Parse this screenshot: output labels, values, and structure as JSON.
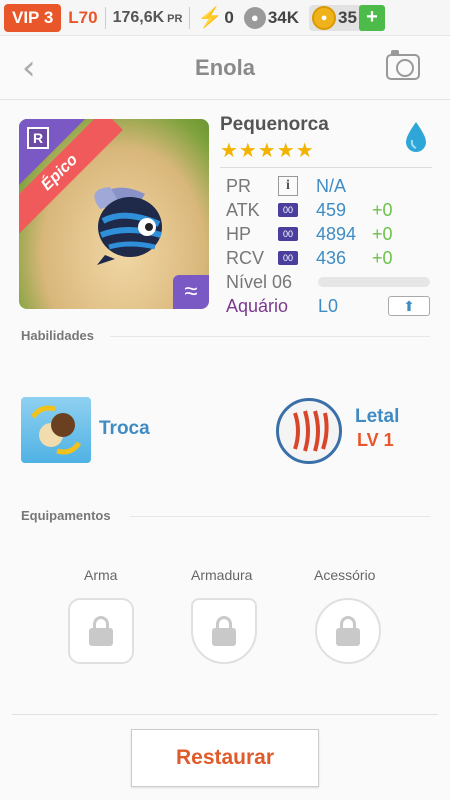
{
  "topbar": {
    "vip": "VIP 3",
    "level": "L70",
    "power": "176,6K",
    "power_unit": "PR",
    "energy": "0",
    "food": "34K",
    "coins": "35",
    "add_label": "+"
  },
  "header": {
    "title": "Enola",
    "back_icon": "chevron-left-icon",
    "camera_icon": "camera-icon"
  },
  "pet": {
    "rarity_badge": "R",
    "rarity": "Épico",
    "element_icon": "water-drop-icon",
    "name": "Pequenorca",
    "stars": 5,
    "stats": [
      {
        "label": "PR",
        "tag": "i",
        "value": "N/A",
        "bonus": ""
      },
      {
        "label": "ATK",
        "tag": "00",
        "value": "459",
        "bonus": "+0"
      },
      {
        "label": "HP",
        "tag": "00",
        "value": "4894",
        "bonus": "+0"
      },
      {
        "label": "RCV",
        "tag": "00",
        "value": "436",
        "bonus": "+0"
      }
    ],
    "level_label": "Nível 06",
    "level_progress": 0,
    "aquarium_label": "Aquário",
    "aquarium_value": "L0"
  },
  "skills": {
    "section_title": "Habilidades",
    "active": {
      "name": "Troca"
    },
    "passive": {
      "name": "Letal",
      "level": "LV 1"
    }
  },
  "equipment": {
    "section_title": "Equipamentos",
    "slots": [
      {
        "label": "Arma"
      },
      {
        "label": "Armadura"
      },
      {
        "label": "Acessório"
      }
    ]
  },
  "actions": {
    "restore_label": "Restaurar"
  },
  "colors": {
    "accent_orange": "#e8562a",
    "value_blue": "#3f8cc4",
    "bonus_green": "#6cc24a",
    "epic_purple": "#7b59c4"
  }
}
